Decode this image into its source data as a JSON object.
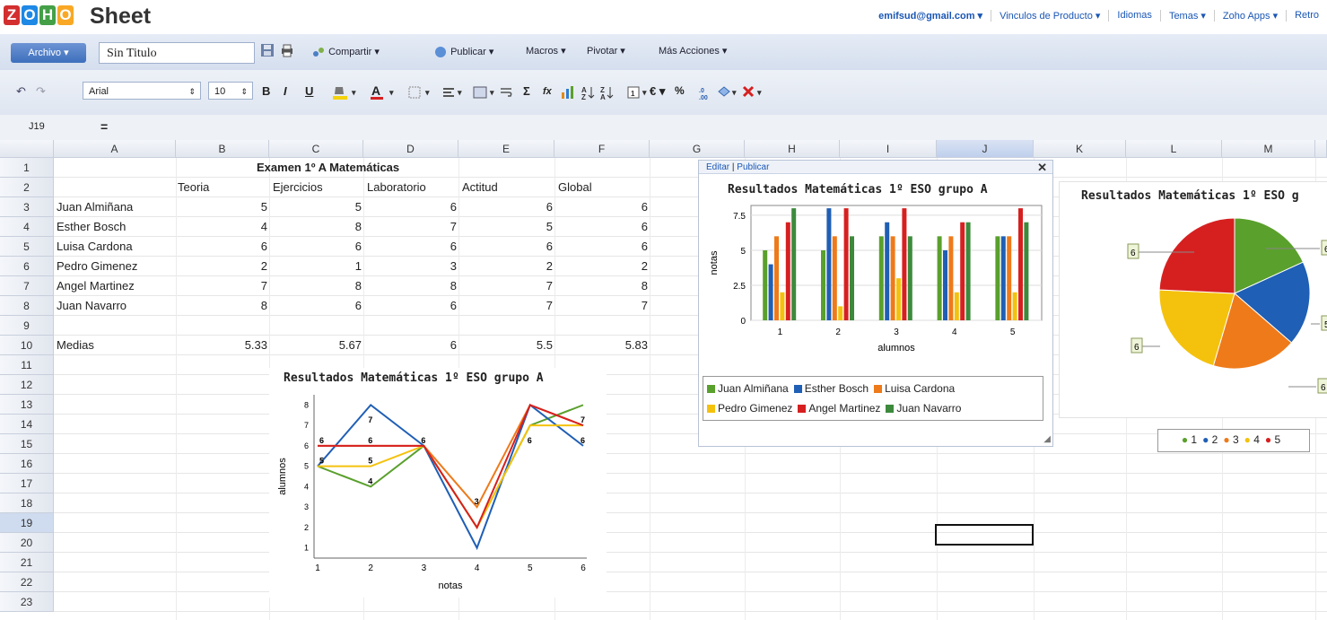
{
  "brand": {
    "app_name": "Sheet",
    "logo_letters": [
      "Z",
      "O",
      "H",
      "O"
    ],
    "logo_colors": [
      "#d32f2f",
      "#1e88e5",
      "#43a047",
      "#f9a825"
    ]
  },
  "topnav": [
    "emifsud@gmail.com ▾",
    "Vinculos de Producto ▾",
    "Idiomas",
    "Temas ▾",
    "Zoho Apps ▾",
    "Retro"
  ],
  "menubar": {
    "file_label": "Archivo ▾",
    "doc_title": "Sin Titulo",
    "share": "Compartir ▾",
    "publish": "Publicar ▾",
    "macros": "Macros ▾",
    "pivot": "Pivotar ▾",
    "more": "Más Acciones ▾"
  },
  "format": {
    "font": "Arial",
    "size": "10",
    "bold": "B",
    "italic": "I",
    "underline": "U",
    "sum": "Σ",
    "fx": "fx",
    "euro": "€ ▾",
    "percent": "%"
  },
  "formula": {
    "cell_ref": "J19",
    "eq": "="
  },
  "grid": {
    "columns": [
      "A",
      "B",
      "C",
      "D",
      "E",
      "F",
      "G",
      "H",
      "I",
      "J",
      "K",
      "L",
      "M"
    ],
    "selected_column": "J",
    "rows": [
      "1",
      "2",
      "3",
      "4",
      "5",
      "6",
      "7",
      "8",
      "9",
      "10",
      "11",
      "12",
      "13",
      "14",
      "15",
      "16",
      "17",
      "18",
      "19",
      "20",
      "21",
      "22",
      "23"
    ],
    "selected_row": "19",
    "title": "Examen 1º A Matemáticas",
    "headers": [
      "Teoria",
      "Ejercicios",
      "Laboratorio",
      "Actitud",
      "Global"
    ],
    "students": [
      {
        "name": "Juan Almiñana",
        "vals": [
          "5",
          "5",
          "6",
          "6",
          "6"
        ]
      },
      {
        "name": "Esther Bosch",
        "vals": [
          "4",
          "8",
          "7",
          "5",
          "6"
        ]
      },
      {
        "name": "Luisa Cardona",
        "vals": [
          "6",
          "6",
          "6",
          "6",
          "6"
        ]
      },
      {
        "name": "Pedro Gimenez",
        "vals": [
          "2",
          "1",
          "3",
          "2",
          "2"
        ]
      },
      {
        "name": "Angel Martinez",
        "vals": [
          "7",
          "8",
          "8",
          "7",
          "8"
        ]
      },
      {
        "name": "Juan Navarro",
        "vals": [
          "8",
          "6",
          "6",
          "7",
          "7"
        ]
      }
    ],
    "averages_label": "Medias",
    "averages": [
      "5.33",
      "5.67",
      "6",
      "5.5",
      "5.83"
    ]
  },
  "panel": {
    "edit": "Editar",
    "publish": "Publicar",
    "close": "✕"
  },
  "charts": {
    "bar_title": "Resultados Matemáticas 1º ESO grupo A",
    "pie_title": "Resultados Matemáticas 1º ESO g",
    "line_title": "Resultados Matemáticas 1º ESO grupo A"
  },
  "chart_data": [
    {
      "type": "bar",
      "title": "Resultados Matemáticas 1º ESO grupo A",
      "xlabel": "alumnos",
      "ylabel": "notas",
      "categories": [
        "1",
        "2",
        "3",
        "4",
        "5"
      ],
      "ylim": [
        0,
        8.2
      ],
      "yticks": [
        "0",
        "2.5",
        "5",
        "7.5"
      ],
      "series": [
        {
          "name": "Juan Almiñana",
          "color": "#5aa02c",
          "values": [
            5,
            5,
            6,
            6,
            6
          ]
        },
        {
          "name": "Esther Bosch",
          "color": "#1f5fb5",
          "values": [
            4,
            8,
            7,
            5,
            6
          ]
        },
        {
          "name": "Luisa  Cardona",
          "color": "#ee7a1a",
          "values": [
            6,
            6,
            6,
            6,
            6
          ]
        },
        {
          "name": "Pedro Gimenez",
          "color": "#f4c20d",
          "values": [
            2,
            1,
            3,
            2,
            2
          ]
        },
        {
          "name": "Angel Martinez",
          "color": "#d62020",
          "values": [
            7,
            8,
            8,
            7,
            8
          ]
        },
        {
          "name": "Juan Navarro",
          "color": "#3d8a3d",
          "values": [
            8,
            6,
            6,
            7,
            7
          ]
        }
      ]
    },
    {
      "type": "line",
      "title": "Resultados Matemáticas 1º ESO grupo A",
      "xlabel": "notas",
      "ylabel": "alumnos",
      "x": [
        "1",
        "2",
        "3",
        "4",
        "5",
        "6"
      ],
      "ylim": [
        0.5,
        8.5
      ],
      "yticks": [
        "1",
        "2",
        "3",
        "4",
        "5",
        "6",
        "7",
        "8"
      ],
      "series": [
        {
          "color": "#5aa02c",
          "values": [
            5,
            4,
            6,
            2,
            7,
            8
          ]
        },
        {
          "color": "#1f5fb5",
          "values": [
            5,
            8,
            6,
            1,
            8,
            6
          ]
        },
        {
          "color": "#ee7a1a",
          "values": [
            6,
            6,
            6,
            3,
            8,
            7
          ]
        },
        {
          "color": "#f4c20d",
          "values": [
            5,
            5,
            6,
            2,
            7,
            7
          ]
        },
        {
          "color": "#d62020",
          "values": [
            6,
            6,
            6,
            2,
            8,
            7
          ]
        }
      ],
      "point_labels": [
        "6",
        "5",
        "7",
        "6",
        "5",
        "4",
        "6",
        "3",
        "6",
        "7",
        "6"
      ]
    },
    {
      "type": "pie",
      "title": "Resultados Matemáticas 1º ESO g",
      "slices": [
        {
          "label": "1",
          "value": 6,
          "color": "#5aa02c"
        },
        {
          "label": "2",
          "value": 6,
          "color": "#1f5fb5"
        },
        {
          "label": "3",
          "value": 6,
          "color": "#ee7a1a"
        },
        {
          "label": "4",
          "value": 7,
          "color": "#f4c20d"
        },
        {
          "label": "5",
          "value": 8,
          "color": "#d62020"
        }
      ],
      "callouts": [
        "6",
        "6",
        "5",
        "6",
        "6"
      ],
      "legend": [
        "1",
        "2",
        "3",
        "4",
        "5"
      ]
    }
  ]
}
